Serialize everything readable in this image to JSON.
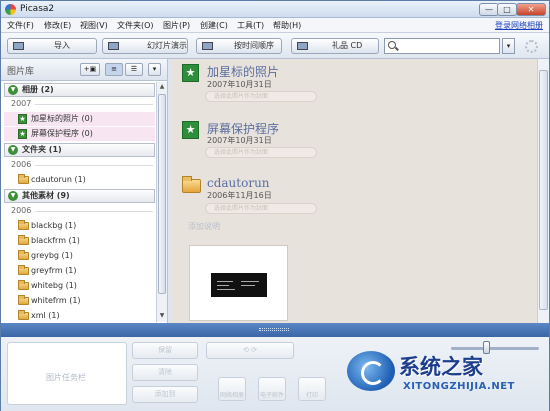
{
  "window": {
    "title": "Picasa2",
    "min": "—",
    "max": "□",
    "close": "✕"
  },
  "menu": {
    "items": [
      "文件(F)",
      "修改(E)",
      "视图(V)",
      "文件夹(O)",
      "图片(P)",
      "创建(C)",
      "工具(T)",
      "帮助(H)"
    ],
    "online_link": "登录网络相册"
  },
  "toolbar": {
    "import": "导入",
    "slideshow": "幻灯片演示",
    "timeline": "按时间顺序",
    "gift_cd": "礼品 CD",
    "search_value": "",
    "search_dropdown": "▾"
  },
  "library": {
    "title": "图片库",
    "add_button": "+▣",
    "view_flat": "≡",
    "view_tree": "☰",
    "menu_button": "▾",
    "groups": [
      {
        "label": "相册 (2)",
        "toggle": "▼",
        "year": "2007",
        "items": [
          {
            "label": "加星标的照片 (0)",
            "icon": "star-album-icon"
          },
          {
            "label": "屏幕保护程序 (0)",
            "icon": "star-album-icon"
          }
        ]
      },
      {
        "label": "文件夹 (1)",
        "toggle": "▼",
        "year": "2006",
        "items": [
          {
            "label": "cdautorun (1)",
            "icon": "folder-icon"
          }
        ]
      },
      {
        "label": "其他素材 (9)",
        "toggle": "▼",
        "year": "2006",
        "items": [
          {
            "label": "blackbg (1)",
            "icon": "folder-icon"
          },
          {
            "label": "blackfrm (1)",
            "icon": "folder-icon"
          },
          {
            "label": "greybg (1)",
            "icon": "folder-icon"
          },
          {
            "label": "greyfrm (1)",
            "icon": "folder-icon"
          },
          {
            "label": "whitebg (1)",
            "icon": "folder-icon"
          },
          {
            "label": "whitefrm (1)",
            "icon": "folder-icon"
          },
          {
            "label": "xml (1)",
            "icon": "folder-icon"
          }
        ]
      }
    ]
  },
  "albums": [
    {
      "title": "加星标的照片",
      "date": "2007年10月31日",
      "pill": "选择此照片作为封面",
      "icon": "star-album-icon",
      "icon_glyph": "★"
    },
    {
      "title": "屏幕保护程序",
      "date": "2007年10月31日",
      "pill": "选择此照片作为封面",
      "icon": "star-album-icon",
      "icon_glyph": "★"
    },
    {
      "title": "cdautorun",
      "date": "2006年11月16日",
      "pill": "选择此照片作为封面",
      "icon": "folder-icon",
      "icon_glyph": "",
      "caption": "添加说明"
    }
  ],
  "tray": {
    "task_label": "图片任务栏",
    "hold": "保留",
    "clear": "清除",
    "add_to": "添加到"
  },
  "tray_tools": [
    {
      "label": "网络相册",
      "icon": "web-album-icon"
    },
    {
      "label": "电子邮件",
      "icon": "email-icon"
    },
    {
      "label": "打印",
      "icon": "print-icon"
    }
  ],
  "zoom": {
    "level": 0.4
  },
  "watermark": {
    "chinese": "系统之家",
    "english": "XITONGZHIJIA.NET"
  }
}
